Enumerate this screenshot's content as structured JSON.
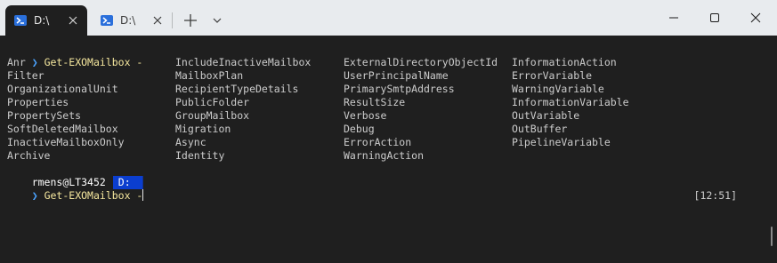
{
  "tabs": [
    {
      "label": "D:\\",
      "active": true
    },
    {
      "label": "D:\\",
      "active": false
    }
  ],
  "terminal": {
    "prompt_chevron": "❯",
    "first_command": "Get-EXOMailbox -",
    "param_rows": [
      [
        "Anr",
        "IncludeInactiveMailbox",
        "ExternalDirectoryObjectId",
        "InformationAction"
      ],
      [
        "Filter",
        "MailboxPlan",
        "UserPrincipalName",
        "ErrorVariable"
      ],
      [
        "OrganizationalUnit",
        "RecipientTypeDetails",
        "PrimarySmtpAddress",
        "WarningVariable"
      ],
      [
        "Properties",
        "PublicFolder",
        "ResultSize",
        "InformationVariable"
      ],
      [
        "PropertySets",
        "GroupMailbox",
        "Verbose",
        "OutVariable"
      ],
      [
        "SoftDeletedMailbox",
        "Migration",
        "Debug",
        "OutBuffer"
      ],
      [
        "InactiveMailboxOnly",
        "Async",
        "ErrorAction",
        "PipelineVariable"
      ],
      [
        "Archive",
        "Identity",
        "WarningAction",
        ""
      ]
    ],
    "user_host": "rmens@LT3452",
    "directory": "D:",
    "time": "[12:51]",
    "second_command": "Get-EXOMailbox -"
  },
  "colors": {
    "accent": "#0b3ecf",
    "command": "#f5e79e",
    "chevron": "#4ba3ff",
    "background": "#1f1f1f"
  },
  "icons": [
    "powershell-icon",
    "close-icon",
    "plus-icon",
    "chevron-down-icon",
    "minimize-icon",
    "maximize-icon",
    "window-close-icon"
  ]
}
